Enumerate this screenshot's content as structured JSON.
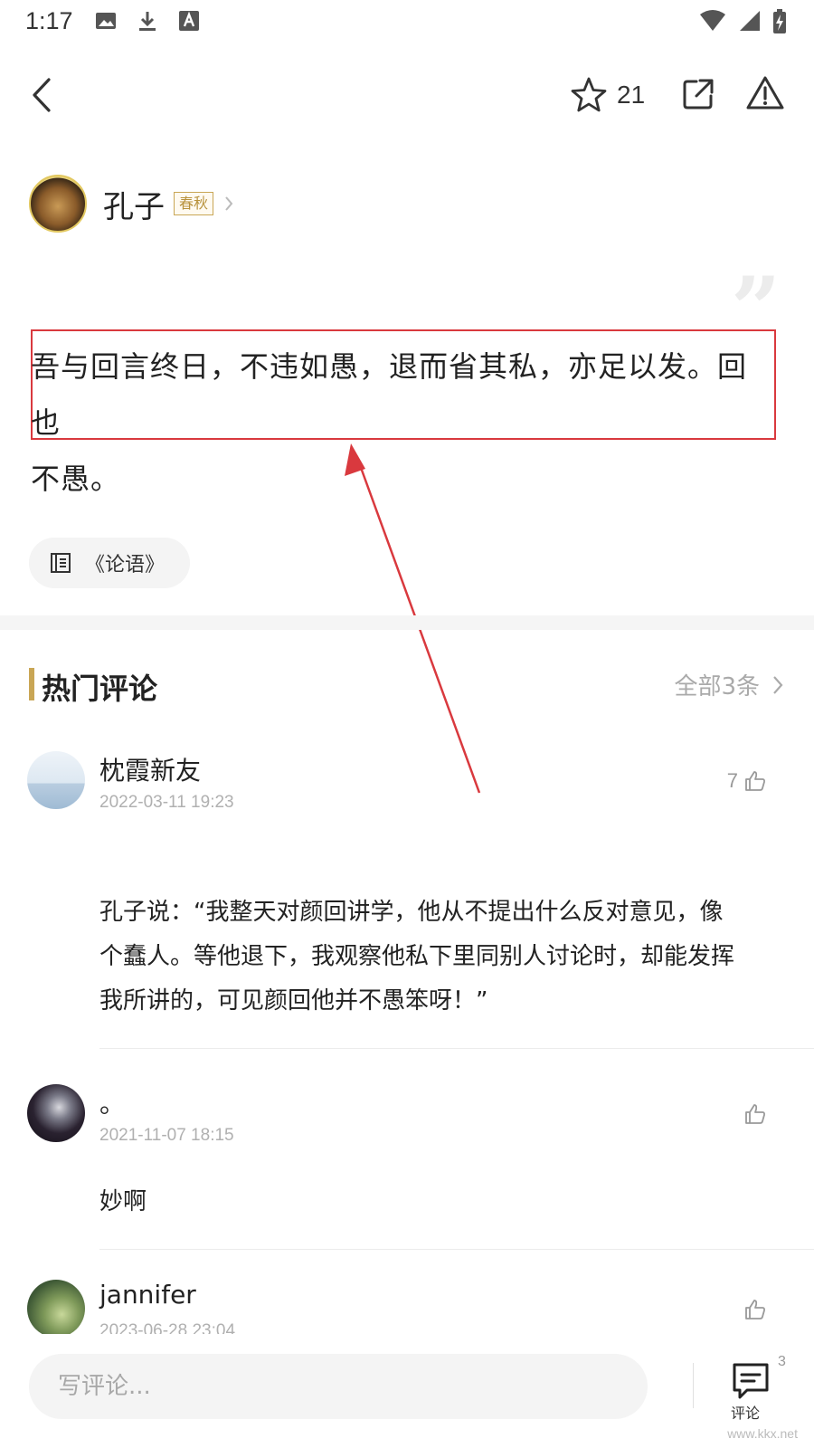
{
  "status_bar": {
    "time": "1:17"
  },
  "top_bar": {
    "star_count": "21"
  },
  "author": {
    "name": "孔子",
    "dynasty": "春秋"
  },
  "quote": {
    "line1": "吾与回言终日，不违如愚，退而省其私，亦足以发。回也",
    "line2": "不愚。"
  },
  "source": {
    "label": "《论语》"
  },
  "comments_section": {
    "title": "热门评论",
    "view_all": "全部3条"
  },
  "comments": [
    {
      "user": "枕霞新友",
      "date": "2022-03-11 19:23",
      "likes": "7",
      "body_lines": [
        "孔子说：“我整天对颜回讲学，他从不提出什么反对意见，像",
        "个蠢人。等他退下，我观察他私下里同别人讨论时，却能发挥",
        "我所讲的，可见颜回他并不愚笨呀！”"
      ]
    },
    {
      "user": "。",
      "date": "2021-11-07 18:15",
      "likes": "",
      "body_lines": [
        "妙啊"
      ]
    },
    {
      "user": "jannifer",
      "date": "2023-06-28 23:04",
      "likes": "",
      "body_lines": []
    }
  ],
  "bottom_bar": {
    "input_placeholder": "写评论...",
    "comment_label": "评论",
    "comment_count": "3"
  },
  "watermark": "www.kkx.net",
  "colors": {
    "accent_gold": "#c9a655",
    "annotation_red": "#d9393e"
  }
}
